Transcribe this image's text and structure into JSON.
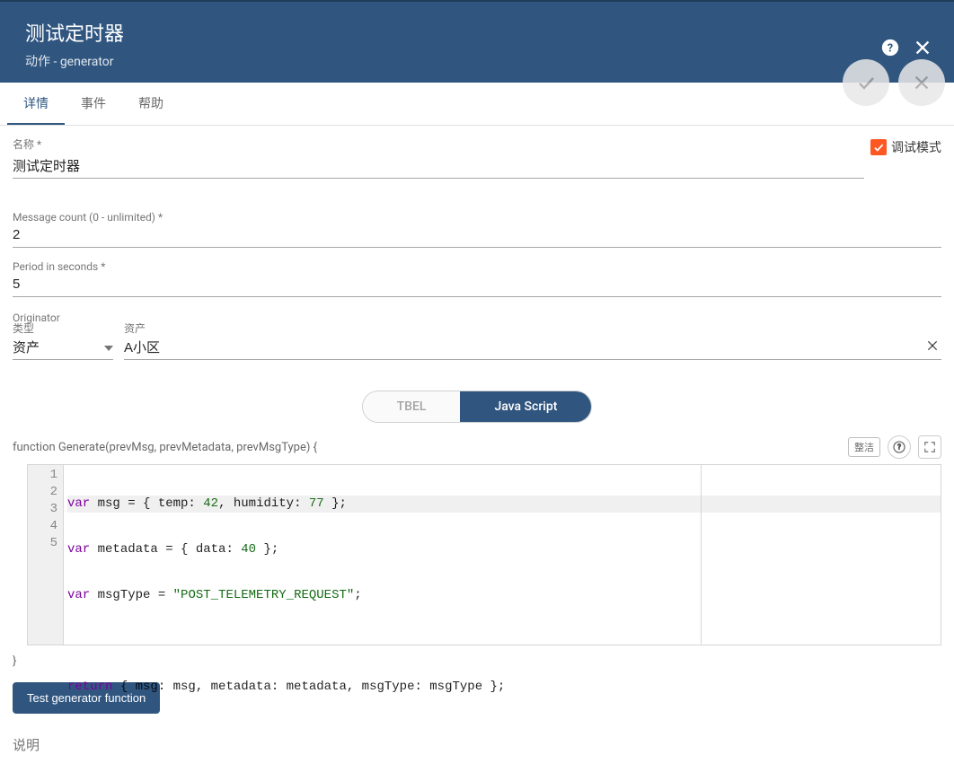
{
  "header": {
    "title": "测试定时器",
    "subtitle": "动作 - generator"
  },
  "tabs": {
    "details": "详情",
    "events": "事件",
    "help": "帮助"
  },
  "fields": {
    "name_label": "名称 *",
    "name_value": "测试定时器",
    "debug_label": "调试模式",
    "msgcount_label": "Message count (0 - unlimited) *",
    "msgcount_value": "2",
    "period_label": "Period in seconds *",
    "period_value": "5",
    "originator_label": "Originator",
    "type_label": "类型",
    "type_value": "资产",
    "asset_label": "资产",
    "asset_value": "A小区"
  },
  "lang": {
    "tbel": "TBEL",
    "js": "Java Script"
  },
  "func": {
    "signature": "function Generate(prevMsg, prevMetadata, prevMsgType) {",
    "tidy": "整洁",
    "close_brace": "}"
  },
  "code": {
    "lines": [
      "1",
      "2",
      "3",
      "4",
      "5"
    ],
    "l1_a": "var",
    "l1_b": " msg = { temp: ",
    "l1_n1": "42",
    "l1_c": ", humidity: ",
    "l1_n2": "77",
    "l1_d": " };",
    "l2_a": "var",
    "l2_b": " metadata = { data: ",
    "l2_n1": "40",
    "l2_c": " };",
    "l3_a": "var",
    "l3_b": " msgType = ",
    "l3_s": "\"POST_TELEMETRY_REQUEST\"",
    "l3_c": ";",
    "l5_a": "return",
    "l5_b": " { msg: msg, metadata: metadata, msgType: msgType };"
  },
  "buttons": {
    "test": "Test generator function"
  },
  "desc_label": "说明"
}
